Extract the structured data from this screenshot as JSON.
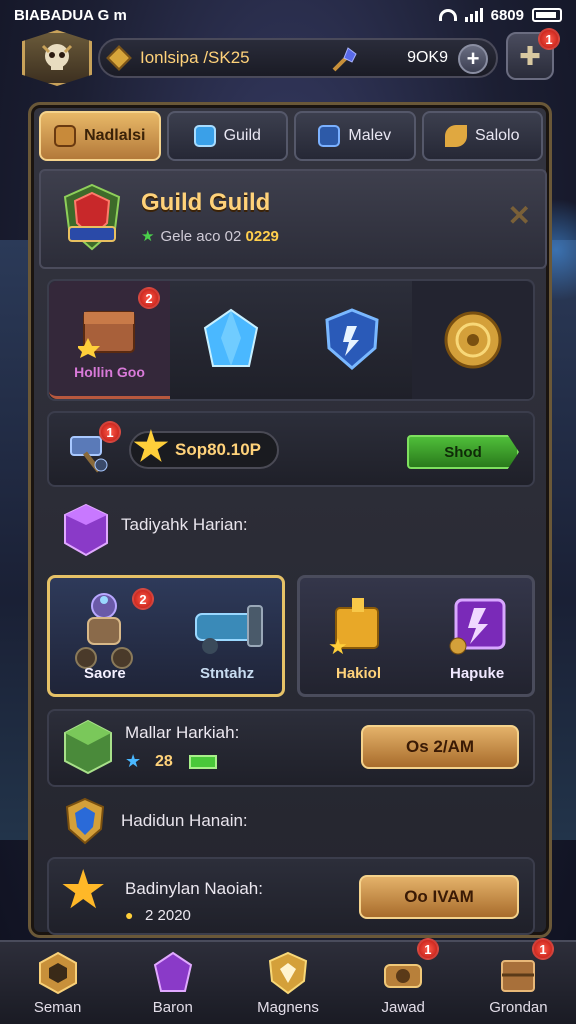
{
  "status_bar": {
    "left_text": "BIABADUA G m",
    "time": "6809"
  },
  "top_bar": {
    "resource_label": "Ionlsipa /SK25",
    "resource_count": "9OK9",
    "notification_badge": "1"
  },
  "tabs": [
    {
      "label": "Nadlalsi"
    },
    {
      "label": "Guild"
    },
    {
      "label": "Malev"
    },
    {
      "label": "Salolo"
    }
  ],
  "guild": {
    "title": "Guild Guild",
    "subtitle_text": "Gele aco 02",
    "subtitle_number": "0229"
  },
  "items_row": {
    "first_badge": "2",
    "first_caption": "Hollin Goo"
  },
  "reward_row": {
    "badge": "1",
    "amount": "Sop80.10P",
    "button_label": "Shod"
  },
  "section1_label": "Tadiyahk Harian:",
  "cards": [
    {
      "label": "Saore",
      "badge": "2"
    },
    {
      "label": "Stntahz"
    },
    {
      "label": "Hakiol"
    },
    {
      "label": "Hapuke"
    }
  ],
  "bar1": {
    "title": "Mallar Harkiah:",
    "value": "28",
    "button_label": "Os 2/AM"
  },
  "section2_label": "Hadidun Hanain:",
  "bar2": {
    "title": "Badinylan Naoiah:",
    "value": "2 2020",
    "button_label": "Oo IVAM"
  },
  "bottom_nav": [
    {
      "label": "Seman"
    },
    {
      "label": "Baron"
    },
    {
      "label": "Magnens"
    },
    {
      "label": "Jawad",
      "badge": "1"
    },
    {
      "label": "Grondan",
      "badge": "1"
    }
  ]
}
